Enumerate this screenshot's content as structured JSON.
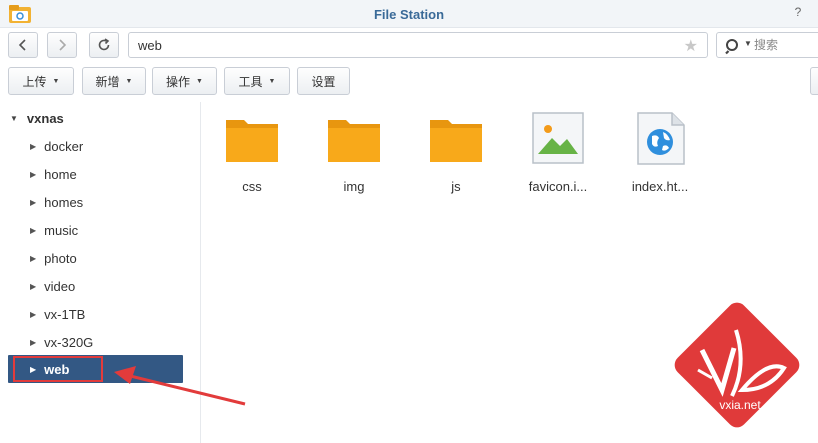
{
  "window": {
    "title": "File Station",
    "help_label": "?"
  },
  "nav": {
    "back_icon": "chevron-left-icon",
    "forward_icon": "chevron-right-icon",
    "refresh_icon": "refresh-icon",
    "path": "web",
    "search_placeholder": "搜索"
  },
  "toolbar": {
    "upload_label": "上传",
    "new_label": "新增",
    "action_label": "操作",
    "tools_label": "工具",
    "settings_label": "设置"
  },
  "sidebar": {
    "root_label": "vxnas",
    "items": [
      {
        "label": "docker"
      },
      {
        "label": "home"
      },
      {
        "label": "homes"
      },
      {
        "label": "music"
      },
      {
        "label": "photo"
      },
      {
        "label": "video"
      },
      {
        "label": "vx-1TB"
      },
      {
        "label": "vx-320G"
      },
      {
        "label": "web",
        "selected": true
      }
    ]
  },
  "files": [
    {
      "name": "css",
      "type": "folder"
    },
    {
      "name": "img",
      "type": "folder"
    },
    {
      "name": "js",
      "type": "folder"
    },
    {
      "name": "favicon.i...",
      "type": "image"
    },
    {
      "name": "index.ht...",
      "type": "html"
    }
  ],
  "watermark": {
    "text": "vxia.net"
  },
  "colors": {
    "title": "#3a6a98",
    "selected_bg": "#335884",
    "folder": "#f8a91a",
    "annotation_red": "#e23b3b",
    "watermark_red": "#e03a3a"
  }
}
